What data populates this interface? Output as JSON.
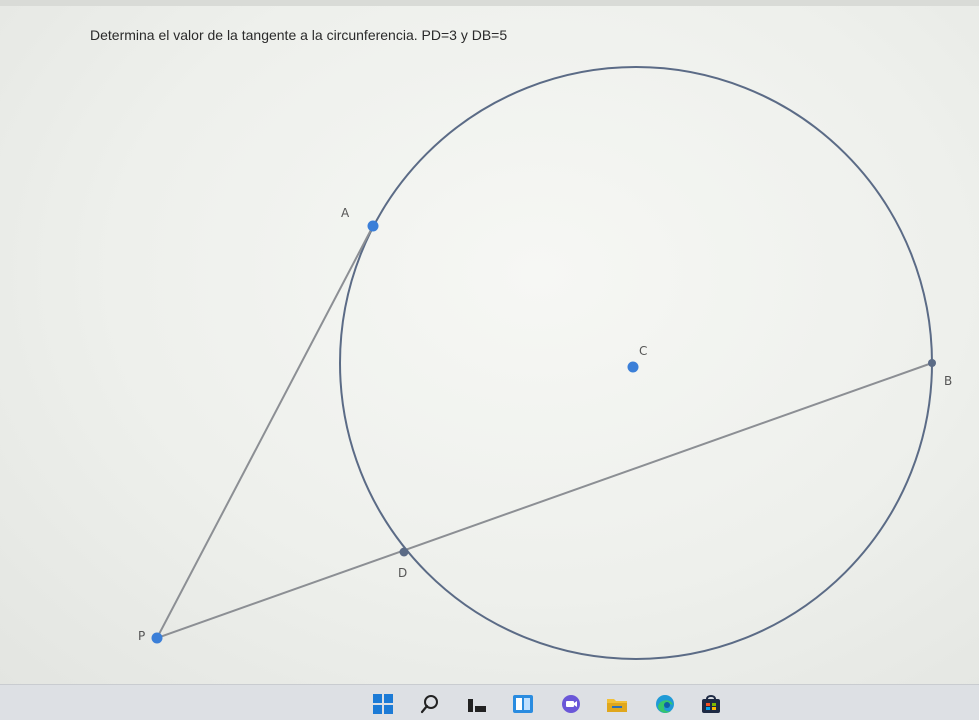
{
  "question": {
    "text": "Determina el valor de la tangente a la circunferencia. PD=3 y DB=5"
  },
  "figure": {
    "points": {
      "A": "A",
      "B": "B",
      "C": "C",
      "D": "D",
      "P": "P"
    }
  },
  "taskbar": {
    "icons": [
      "start-icon",
      "search-icon",
      "task-view-icon",
      "widgets-icon",
      "chat-icon",
      "file-explorer-icon",
      "edge-browser-icon",
      "store-icon"
    ]
  },
  "colors": {
    "circle_stroke": "#5b6b86",
    "line_stroke": "#8c8f94",
    "point_fill": "#3b7fd8"
  }
}
